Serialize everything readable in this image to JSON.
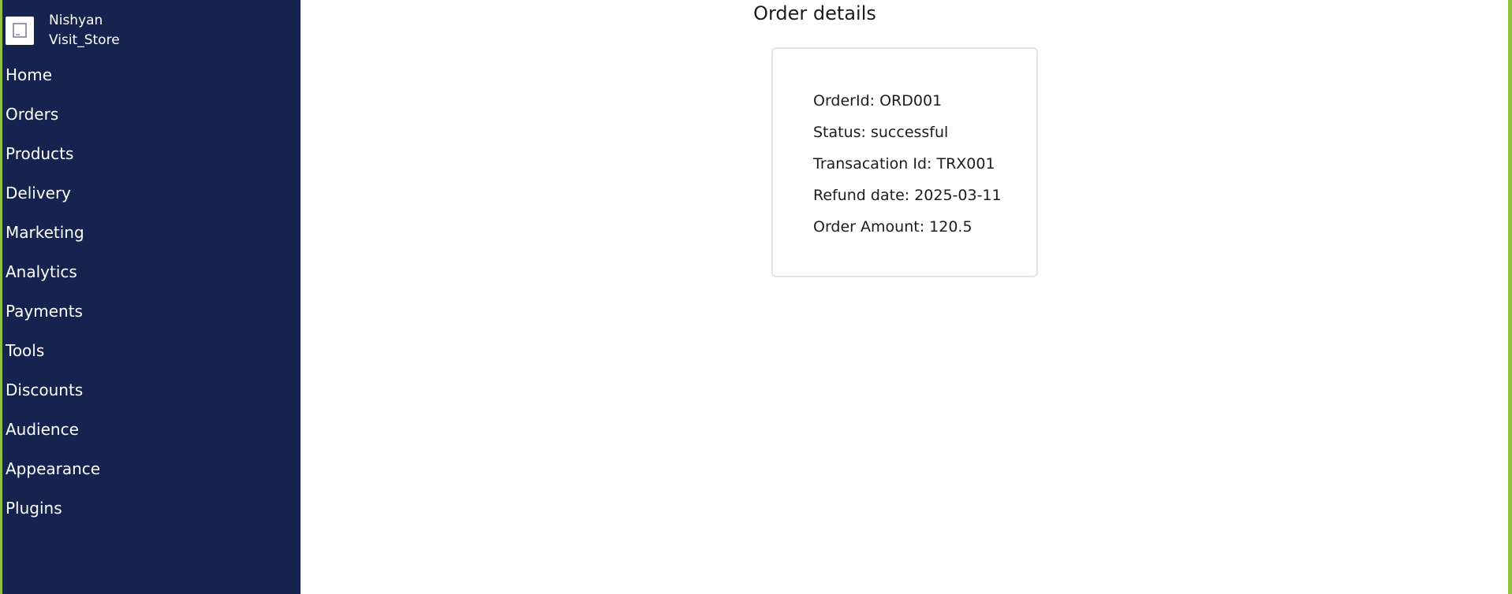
{
  "brand": {
    "owner": "Nishyan",
    "store": "Visit_Store",
    "logo_icon": "store-logo-icon"
  },
  "sidebar": {
    "items": [
      {
        "label": "Home"
      },
      {
        "label": "Orders"
      },
      {
        "label": "Products"
      },
      {
        "label": "Delivery"
      },
      {
        "label": "Marketing"
      },
      {
        "label": "Analytics"
      },
      {
        "label": "Payments"
      },
      {
        "label": "Tools"
      },
      {
        "label": "Discounts"
      },
      {
        "label": "Audience"
      },
      {
        "label": "Appearance"
      },
      {
        "label": "Plugins"
      }
    ]
  },
  "main": {
    "title": "Order details",
    "details": {
      "order_id": "OrderId: ORD001",
      "status": "Status: successful",
      "transaction_id": "Transacation Id: TRX001",
      "refund_date": "Refund date: 2025-03-11",
      "order_amount": "Order Amount: 120.5"
    }
  },
  "colors": {
    "sidebar_bg": "#17234f",
    "accent_edge": "#8fc23c",
    "text": "#1c1c1c"
  }
}
